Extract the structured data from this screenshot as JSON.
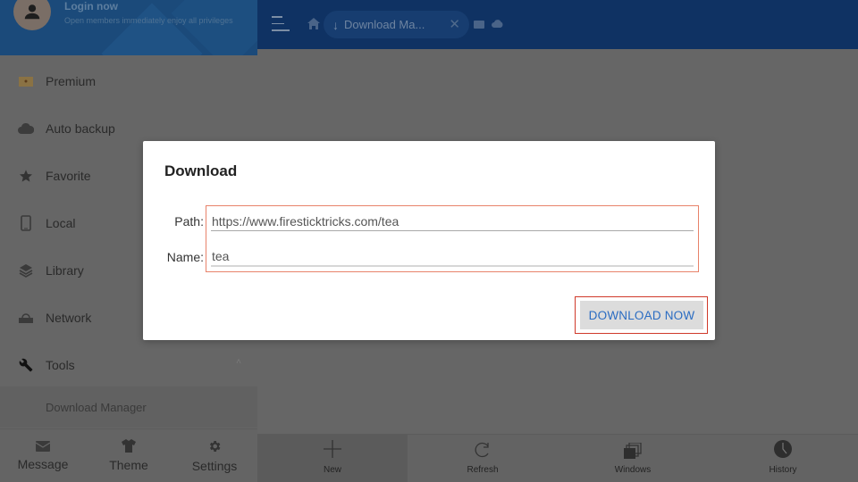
{
  "sidebar": {
    "header": {
      "login_title": "Login now",
      "login_subtitle": "Open members immediately enjoy all privileges",
      "avatar_icon": "person-icon"
    },
    "items": [
      {
        "label": "Premium",
        "icon": "crown-icon"
      },
      {
        "label": "Auto backup",
        "icon": "cloud-sync-icon"
      },
      {
        "label": "Favorite",
        "icon": "star-icon"
      },
      {
        "label": "Local",
        "icon": "phone-icon"
      },
      {
        "label": "Library",
        "icon": "layers-icon"
      },
      {
        "label": "Network",
        "icon": "network-drive-icon"
      },
      {
        "label": "Tools",
        "icon": "wrench-icon",
        "expanded": true
      }
    ],
    "submenu": {
      "label": "Download Manager"
    },
    "footer": [
      {
        "label": "Message",
        "icon": "envelope-icon"
      },
      {
        "label": "Theme",
        "icon": "shirt-icon"
      },
      {
        "label": "Settings",
        "icon": "gear-icon"
      }
    ]
  },
  "topbar": {
    "menu_icon": "hamburger-icon",
    "home_icon": "home-icon",
    "tab": {
      "label": "Download Ma...",
      "icon": "download-arrow-icon"
    },
    "extra_icons": [
      "bookmark-icon",
      "cloud-icon"
    ]
  },
  "bottombar": {
    "buttons": [
      {
        "label": "New",
        "icon": "plus-icon",
        "active": true
      },
      {
        "label": "Refresh",
        "icon": "refresh-icon"
      },
      {
        "label": "Windows",
        "icon": "windows-stack-icon"
      },
      {
        "label": "History",
        "icon": "clock-icon"
      }
    ]
  },
  "dialog": {
    "title": "Download",
    "path_label": "Path:",
    "path_value": "https://www.firesticktricks.com/tea",
    "name_label": "Name:",
    "name_value": "tea",
    "download_button": "DOWNLOAD NOW",
    "highlight_color": "#e8826a",
    "button_text_color": "#2a6cc2"
  }
}
